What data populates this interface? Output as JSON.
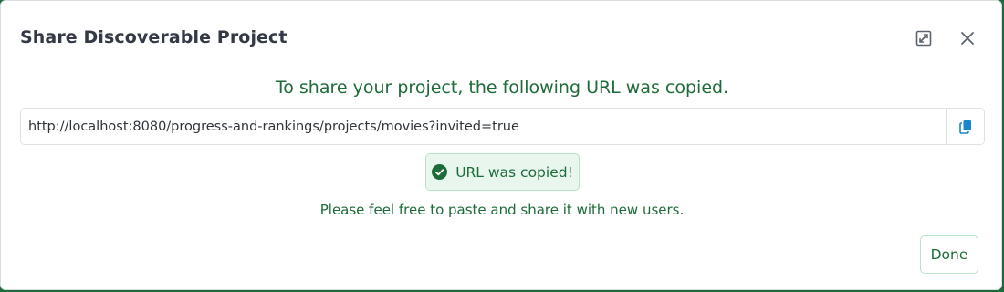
{
  "dialog": {
    "title": "Share Discoverable Project",
    "message": "To share your project, the following URL was copied.",
    "url": "http://localhost:8080/progress-and-rankings/projects/movies?invited=true",
    "copied_badge": "URL was copied!",
    "hint": "Please feel free to paste and share it with new users.",
    "done_label": "Done"
  },
  "icons": {
    "expand": "external-link-icon",
    "close": "close-icon",
    "copy": "copy-icon",
    "check": "check-circle-icon"
  },
  "colors": {
    "success_text": "#1e6b3a",
    "success_bg": "#e9f6ee",
    "success_border": "#b9e3c7",
    "copy_icon": "#1a86c9",
    "title": "#333a45"
  }
}
